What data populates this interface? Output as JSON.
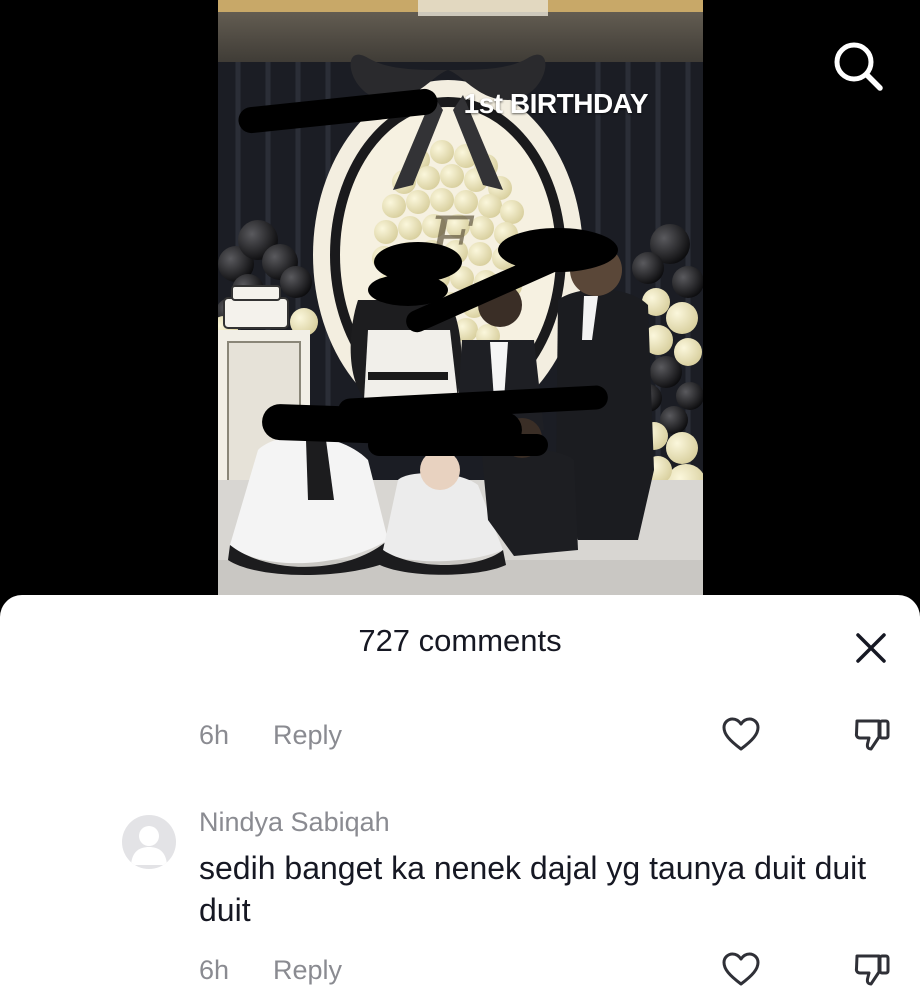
{
  "video": {
    "title": "1st BIRTHDAY"
  },
  "search": {
    "icon": "search-icon"
  },
  "comments_sheet": {
    "title": "727 comments",
    "close_icon": "close-icon",
    "comments": [
      {
        "author": "",
        "text": "",
        "time": "6h",
        "reply_label": "Reply"
      },
      {
        "author": "Nindya Sabiqah",
        "text": "sedih banget ka nenek dajal yg taunya duit duit duit",
        "time": "6h",
        "reply_label": "Reply"
      }
    ]
  },
  "colors": {
    "sheet_bg": "#ffffff",
    "text_primary": "#161823",
    "text_secondary": "#8a8b91",
    "icon": "#2f3037"
  }
}
